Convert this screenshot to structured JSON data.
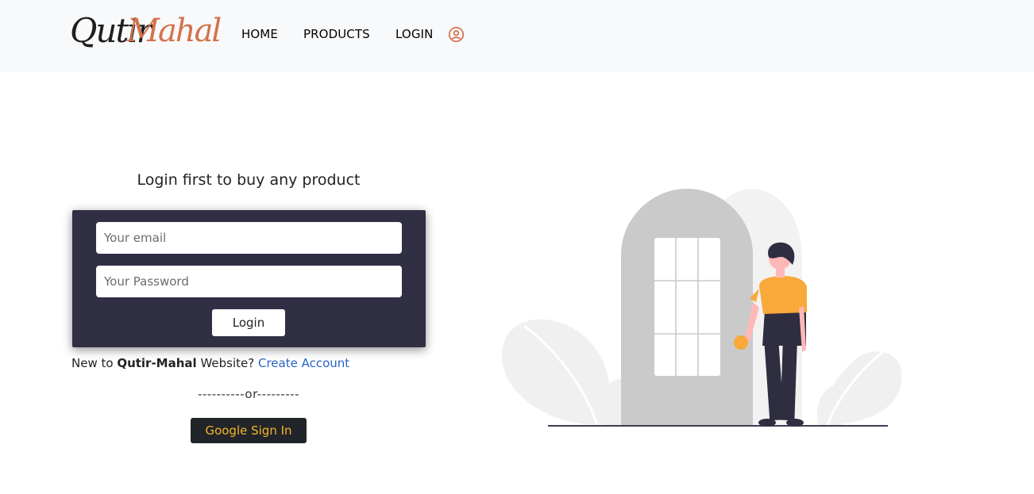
{
  "brand": {
    "logo_part1": "Qutir",
    "logo_part2": "Mahal",
    "logo_alt": "QutirMahal"
  },
  "nav": {
    "home": "HOME",
    "products": "PRODUCTS",
    "login": "LOGIN",
    "user_icon": "user-circle-icon"
  },
  "login": {
    "heading": "Login first to buy any product",
    "email_placeholder": "Your email",
    "password_placeholder": "Your Password",
    "submit_label": "Login"
  },
  "signup_prompt": {
    "prefix": "New to ",
    "brand": "Qutir-Mahal",
    "suffix": " Website? ",
    "link": "Create Account"
  },
  "divider": "----------or---------",
  "google_button": "Google Sign In",
  "colors": {
    "navbar_bg": "#f8f9fa",
    "card_bg": "#302f44",
    "accent_orange": "#d3724a",
    "link_blue": "#2764c8",
    "google_text": "#f5b628",
    "person_shirt": "#f9a83a"
  }
}
